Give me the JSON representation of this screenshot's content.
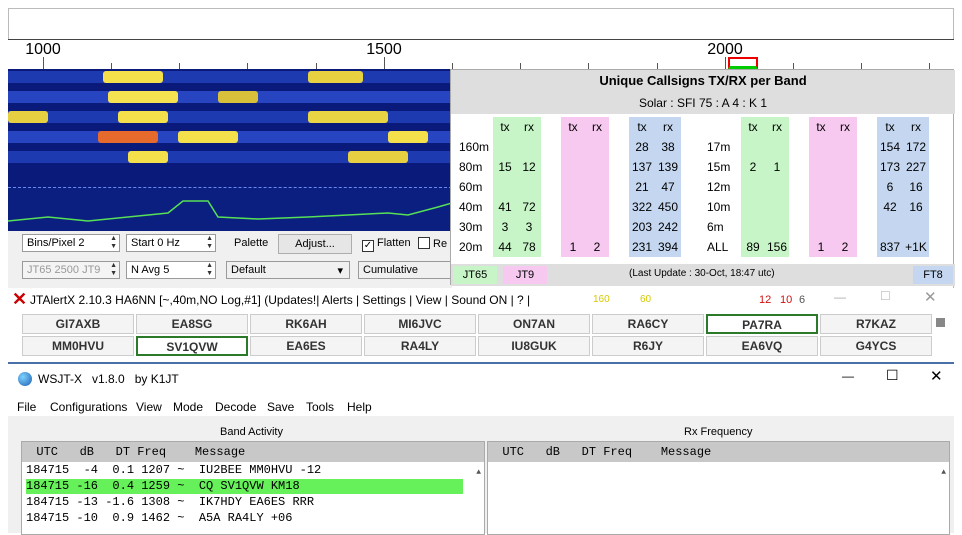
{
  "scale": {
    "labels": [
      "1000",
      "1500",
      "2000"
    ]
  },
  "waterfall": {
    "bins_label": "Bins/Pixel",
    "bins_value": "2",
    "start_label": "Start 0 Hz",
    "palette_label": "Palette",
    "adjust_label": "Adjust...",
    "flatten_label": "Flatten",
    "ref_label": "Re",
    "jt65_label": "JT65",
    "jt65_value": "2500",
    "jt9_label": "JT9",
    "navg_label": "N Avg 5",
    "palette_value": "Default",
    "spectrum_label": "Cumulative"
  },
  "callsign_table": {
    "title": "Unique Callsigns TX/RX per Band",
    "solar": "Solar : SFI 75 : A 4 : K 1",
    "col_tx": "tx",
    "col_rx": "rx",
    "rows": [
      {
        "band": "160m",
        "a_tx": "",
        "a_rx": "",
        "b_tx": "",
        "b_rx": "",
        "c_tx": "28",
        "c_rx": "38",
        "band2": "17m",
        "d_tx": "",
        "d_rx": "",
        "e_tx": "",
        "e_rx": "",
        "f_tx": "154",
        "f_rx": "172"
      },
      {
        "band": "80m",
        "a_tx": "15",
        "a_rx": "12",
        "b_tx": "",
        "b_rx": "",
        "c_tx": "137",
        "c_rx": "139",
        "band2": "15m",
        "d_tx": "2",
        "d_rx": "1",
        "e_tx": "",
        "e_rx": "",
        "f_tx": "173",
        "f_rx": "227"
      },
      {
        "band": "60m",
        "a_tx": "",
        "a_rx": "",
        "b_tx": "",
        "b_rx": "",
        "c_tx": "21",
        "c_rx": "47",
        "band2": "12m",
        "d_tx": "",
        "d_rx": "",
        "e_tx": "",
        "e_rx": "",
        "f_tx": "6",
        "f_rx": "16"
      },
      {
        "band": "40m",
        "a_tx": "41",
        "a_rx": "72",
        "b_tx": "",
        "b_rx": "",
        "c_tx": "322",
        "c_rx": "450",
        "band2": "10m",
        "d_tx": "",
        "d_rx": "",
        "e_tx": "",
        "e_rx": "",
        "f_tx": "42",
        "f_rx": "16"
      },
      {
        "band": "30m",
        "a_tx": "3",
        "a_rx": "3",
        "b_tx": "",
        "b_rx": "",
        "c_tx": "203",
        "c_rx": "242",
        "band2": "6m",
        "d_tx": "",
        "d_rx": "",
        "e_tx": "",
        "e_rx": "",
        "f_tx": "",
        "f_rx": ""
      },
      {
        "band": "20m",
        "a_tx": "44",
        "a_rx": "78",
        "b_tx": "1",
        "b_rx": "2",
        "c_tx": "231",
        "c_rx": "394",
        "band2": "ALL",
        "d_tx": "89",
        "d_rx": "156",
        "e_tx": "1",
        "e_rx": "2",
        "f_tx": "837",
        "f_rx": "+1K"
      }
    ],
    "foot_jt65": "JT65",
    "foot_jt9": "JT9",
    "foot_update": "(Last Update : 30-Oct, 18:47 utc)",
    "foot_ft8": "FT8"
  },
  "alert": {
    "title": "JTAlertX 2.10.3 HA6NN [~,40m,NO Log,#1] (Updates!| Alerts | Settings | View | Sound ON | ? |",
    "n1": "160",
    "n2": "60",
    "n3": "12",
    "n4": "10",
    "n5": "6",
    "calls": [
      "GI7AXB",
      "EA8SG",
      "RK6AH",
      "MI6JVC",
      "ON7AN",
      "RA6CY",
      "PA7RA",
      "R7KAZ",
      "MM0HVU",
      "SV1QVW",
      "EA6ES",
      "RA4LY",
      "IU8GUK",
      "R6JY",
      "EA6VQ",
      "G4YCS"
    ]
  },
  "wsjt": {
    "title": "WSJT-X   v1.8.0   by K1JT",
    "menu": [
      "File",
      "Configurations",
      "View",
      "Mode",
      "Decode",
      "Save",
      "Tools",
      "Help"
    ],
    "band_activity": "Band Activity",
    "rx_frequency": "Rx Frequency",
    "left_header": "  UTC   dB   DT Freq    Message",
    "right_header": "  UTC   dB   DT Freq    Message",
    "lines": [
      "184715  -4  0.1 1207 ~  IU2BEE MM0HVU -12",
      "184715 -16  0.4 1259 ~  CQ SV1QVW KM18",
      "184715 -13 -1.6 1308 ~  IK7HDY EA6ES RRR",
      "184715 -10  0.9 1462 ~  A5A RA4LY +06"
    ]
  },
  "colors": {
    "green_highlight": "#66f05a",
    "title_bar": "#4b6fa8"
  }
}
